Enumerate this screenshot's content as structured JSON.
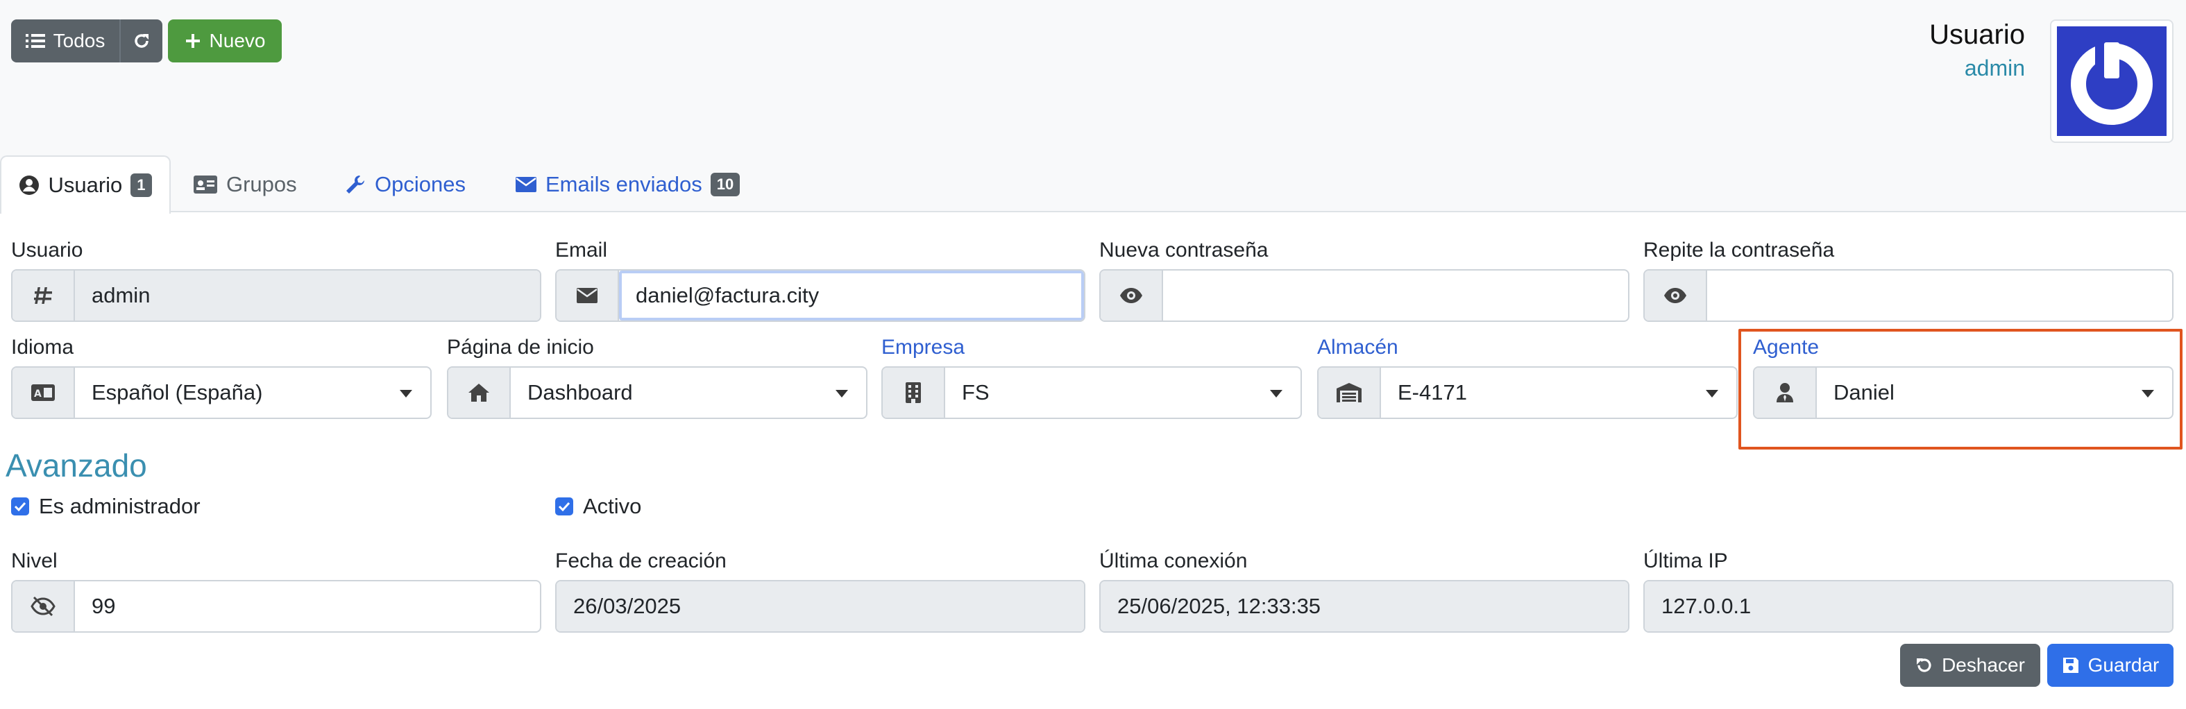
{
  "toolbar": {
    "todos_label": "Todos",
    "nuevo_label": "Nuevo"
  },
  "header": {
    "title": "Usuario",
    "username": "admin"
  },
  "tabs": [
    {
      "label": "Usuario",
      "badge": "1"
    },
    {
      "label": "Grupos"
    },
    {
      "label": "Opciones"
    },
    {
      "label": "Emails enviados",
      "badge": "10"
    }
  ],
  "form": {
    "usuario": {
      "label": "Usuario",
      "value": "admin"
    },
    "email": {
      "label": "Email",
      "value": "daniel@factura.city"
    },
    "nueva_contrasena": {
      "label": "Nueva contraseña",
      "value": ""
    },
    "repite_contrasena": {
      "label": "Repite la contraseña",
      "value": ""
    },
    "idioma": {
      "label": "Idioma",
      "value": "Español (España)"
    },
    "pagina_inicio": {
      "label": "Página de inicio",
      "value": "Dashboard"
    },
    "empresa": {
      "label": "Empresa",
      "value": "FS"
    },
    "almacen": {
      "label": "Almacén",
      "value": "E-4171"
    },
    "agente": {
      "label": "Agente",
      "value": "Daniel"
    }
  },
  "avanzado": {
    "title": "Avanzado",
    "es_administrador": {
      "label": "Es administrador",
      "checked": true
    },
    "activo": {
      "label": "Activo",
      "checked": true
    },
    "nivel": {
      "label": "Nivel",
      "value": "99"
    },
    "fecha_creacion": {
      "label": "Fecha de creación",
      "value": "26/03/2025"
    },
    "ultima_conexion": {
      "label": "Última conexión",
      "value": "25/06/2025, 12:33:35"
    },
    "ultima_ip": {
      "label": "Última IP",
      "value": "127.0.0.1"
    }
  },
  "actions": {
    "deshacer_label": "Deshacer",
    "guardar_label": "Guardar"
  },
  "colors": {
    "primary": "#2f6fe8",
    "success": "#4e9a3f",
    "secondary": "#5a6268",
    "highlight": "#e0551f",
    "avatar_bg": "#2e3ec4"
  }
}
